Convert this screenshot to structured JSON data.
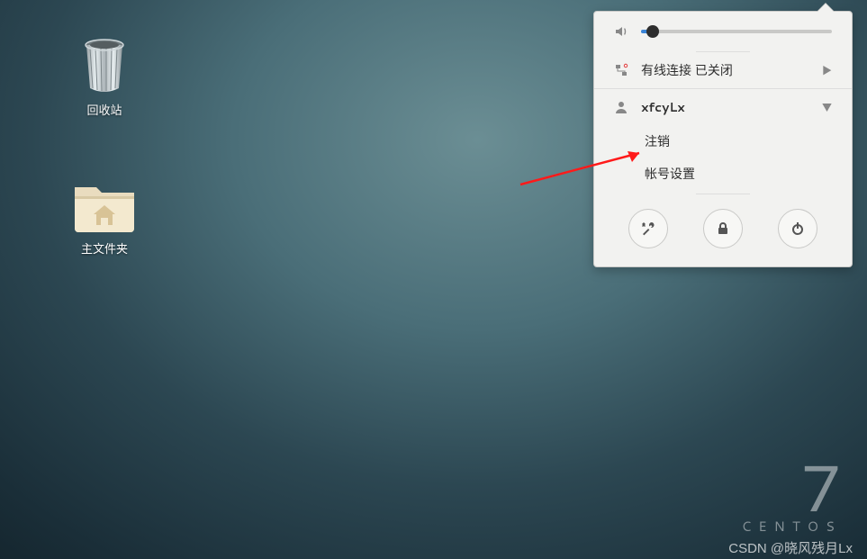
{
  "desktop": {
    "trash_label": "回收站",
    "home_label": "主文件夹"
  },
  "menu": {
    "network_label": "有线连接 已关闭",
    "username": "xfcyLx",
    "logout_label": "注销",
    "account_settings_label": "帐号设置",
    "volume_percent": 6
  },
  "brand": {
    "version": "7",
    "name": "CENTOS"
  },
  "watermark": "CSDN @晓风残月Lx"
}
